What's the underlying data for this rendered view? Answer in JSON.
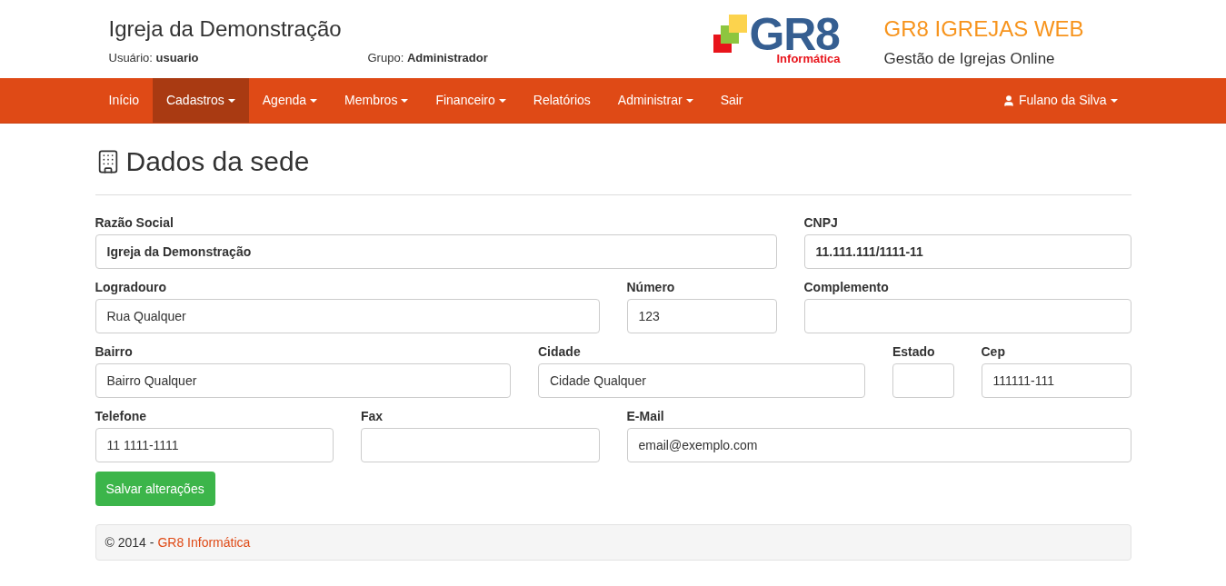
{
  "header": {
    "title": "Igreja da Demonstração",
    "user_label": "Usuário:",
    "user": "usuario",
    "group_label": "Grupo:",
    "group": "Administrador",
    "logo_text": "GR8",
    "logo_subtext": "Informática",
    "product": "GR8 IGREJAS WEB",
    "tagline": "Gestão de Igrejas Online"
  },
  "nav": {
    "items": [
      {
        "label": "Início",
        "dropdown": false,
        "selected": false
      },
      {
        "label": "Cadastros",
        "dropdown": true,
        "selected": true
      },
      {
        "label": "Agenda",
        "dropdown": true,
        "selected": false
      },
      {
        "label": "Membros",
        "dropdown": true,
        "selected": false
      },
      {
        "label": "Financeiro",
        "dropdown": true,
        "selected": false
      },
      {
        "label": "Relatórios",
        "dropdown": false,
        "selected": false
      },
      {
        "label": "Administrar",
        "dropdown": true,
        "selected": false
      },
      {
        "label": "Sair",
        "dropdown": false,
        "selected": false
      }
    ],
    "user": "Fulano da Silva"
  },
  "page_title": "Dados da sede",
  "form_rows": [
    [
      {
        "label": "Razão Social",
        "value": "Igreja da Demonstração",
        "bold": true
      },
      {
        "label": "CNPJ",
        "value": "11.111.111/1111-11",
        "bold": true
      }
    ],
    [
      {
        "label": "Logradouro",
        "value": "Rua Qualquer",
        "bold": false
      },
      {
        "label": "Número",
        "value": "123",
        "bold": false
      },
      {
        "label": "Complemento"
      }
    ],
    [
      {
        "label": "Bairro",
        "value": "Bairro Qualquer",
        "bold": false
      },
      {
        "label": "Cidade",
        "value": "Cidade Qualquer",
        "bold": false
      },
      {
        "label": "Estado"
      },
      {
        "label": "Cep",
        "value": "111111-111",
        "bold": false
      }
    ],
    [
      {
        "label": "Telefone",
        "value": "11 1111-1111",
        "bold": false
      },
      {
        "label": "Fax"
      },
      {
        "label": "E-Mail",
        "value": "email@exemplo.com",
        "bold": false
      }
    ]
  ],
  "save_button": "Salvar alterações",
  "footer": {
    "text": "© 2014 -",
    "link": "GR8 Informática"
  }
}
